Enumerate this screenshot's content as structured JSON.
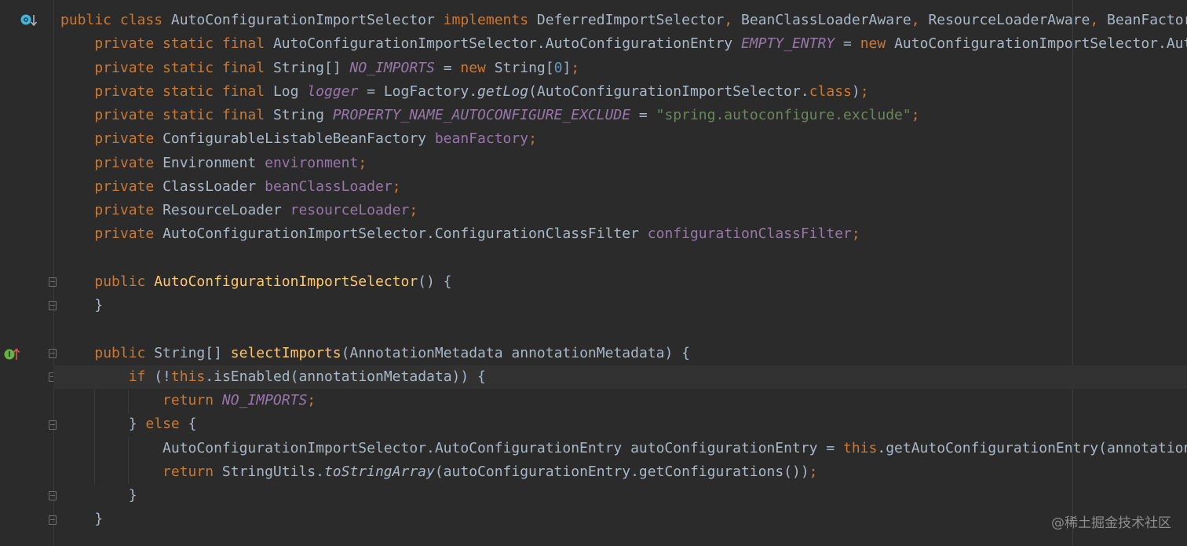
{
  "editor": {
    "lines": [
      {
        "indent": 0,
        "tokens": [
          [
            "kw",
            "public class "
          ],
          [
            "pl",
            "AutoConfigurationImportSelector "
          ],
          [
            "kw",
            "implements "
          ],
          [
            "pl",
            "DeferredImportSelector"
          ],
          [
            "kw",
            ", "
          ],
          [
            "pl",
            "BeanClassLoaderAware"
          ],
          [
            "kw",
            ", "
          ],
          [
            "pl",
            "ResourceLoaderAware"
          ],
          [
            "kw",
            ", "
          ],
          [
            "pl",
            "BeanFactoryAware"
          ]
        ]
      },
      {
        "indent": 1,
        "tokens": [
          [
            "kw",
            "private static final "
          ],
          [
            "pl",
            "AutoConfigurationImportSelector.AutoConfigurationEntry "
          ],
          [
            "cst",
            "EMPTY_ENTRY"
          ],
          [
            "pl",
            " = "
          ],
          [
            "kw",
            "new "
          ],
          [
            "pl",
            "AutoConfigurationImportSelector.AutoConfigurationEntry();"
          ]
        ]
      },
      {
        "indent": 1,
        "tokens": [
          [
            "kw",
            "private static final "
          ],
          [
            "pl",
            "String[] "
          ],
          [
            "cst",
            "NO_IMPORTS"
          ],
          [
            "pl",
            " = "
          ],
          [
            "kw",
            "new "
          ],
          [
            "pl",
            "String["
          ],
          [
            "num",
            "0"
          ],
          [
            "pl",
            "]"
          ],
          [
            "kw",
            ";"
          ]
        ]
      },
      {
        "indent": 1,
        "tokens": [
          [
            "kw",
            "private static final "
          ],
          [
            "pl",
            "Log "
          ],
          [
            "cst",
            "logger"
          ],
          [
            "pl",
            " = LogFactory."
          ],
          [
            "ital",
            "getLog"
          ],
          [
            "pl",
            "(AutoConfigurationImportSelector."
          ],
          [
            "kw",
            "class"
          ],
          [
            "pl",
            ")"
          ],
          [
            "kw",
            ";"
          ]
        ]
      },
      {
        "indent": 1,
        "tokens": [
          [
            "kw",
            "private static final "
          ],
          [
            "pl",
            "String "
          ],
          [
            "cst",
            "PROPERTY_NAME_AUTOCONFIGURE_EXCLUDE"
          ],
          [
            "pl",
            " = "
          ],
          [
            "str",
            "\"spring.autoconfigure.exclude\""
          ],
          [
            "kw",
            ";"
          ]
        ]
      },
      {
        "indent": 1,
        "tokens": [
          [
            "kw",
            "private "
          ],
          [
            "pl",
            "ConfigurableListableBeanFactory "
          ],
          [
            "fld",
            "beanFactory"
          ],
          [
            "kw",
            ";"
          ]
        ]
      },
      {
        "indent": 1,
        "tokens": [
          [
            "kw",
            "private "
          ],
          [
            "pl",
            "Environment "
          ],
          [
            "fld",
            "environment"
          ],
          [
            "kw",
            ";"
          ]
        ]
      },
      {
        "indent": 1,
        "tokens": [
          [
            "kw",
            "private "
          ],
          [
            "pl",
            "ClassLoader "
          ],
          [
            "fld",
            "beanClassLoader"
          ],
          [
            "kw",
            ";"
          ]
        ]
      },
      {
        "indent": 1,
        "tokens": [
          [
            "kw",
            "private "
          ],
          [
            "pl",
            "ResourceLoader "
          ],
          [
            "fld",
            "resourceLoader"
          ],
          [
            "kw",
            ";"
          ]
        ]
      },
      {
        "indent": 1,
        "tokens": [
          [
            "kw",
            "private "
          ],
          [
            "pl",
            "AutoConfigurationImportSelector.ConfigurationClassFilter "
          ],
          [
            "fld",
            "configurationClassFilter"
          ],
          [
            "kw",
            ";"
          ]
        ]
      },
      {
        "indent": 0,
        "tokens": []
      },
      {
        "indent": 1,
        "tokens": [
          [
            "kw",
            "public "
          ],
          [
            "fn",
            "AutoConfigurationImportSelector"
          ],
          [
            "pl",
            "() {"
          ]
        ]
      },
      {
        "indent": 1,
        "tokens": [
          [
            "pl",
            "}"
          ]
        ]
      },
      {
        "indent": 0,
        "tokens": []
      },
      {
        "indent": 1,
        "tokens": [
          [
            "kw",
            "public "
          ],
          [
            "pl",
            "String[] "
          ],
          [
            "fn",
            "selectImports"
          ],
          [
            "pl",
            "(AnnotationMetadata annotationMetadata) {"
          ]
        ]
      },
      {
        "indent": 2,
        "current": true,
        "tokens": [
          [
            "kw",
            "if "
          ],
          [
            "pl",
            "(!"
          ],
          [
            "kw",
            "this"
          ],
          [
            "pl",
            ".isEnabled(annotationMetadata)) {"
          ]
        ]
      },
      {
        "indent": 3,
        "tokens": [
          [
            "kw",
            "return "
          ],
          [
            "cst",
            "NO_IMPORTS"
          ],
          [
            "kw",
            ";"
          ]
        ]
      },
      {
        "indent": 2,
        "tokens": [
          [
            "pl",
            "} "
          ],
          [
            "kw",
            "else "
          ],
          [
            "pl",
            "{"
          ]
        ]
      },
      {
        "indent": 3,
        "tokens": [
          [
            "pl",
            "AutoConfigurationImportSelector.AutoConfigurationEntry autoConfigurationEntry = "
          ],
          [
            "kw",
            "this"
          ],
          [
            "pl",
            ".getAutoConfigurationEntry(annotationMetadata);"
          ]
        ]
      },
      {
        "indent": 3,
        "tokens": [
          [
            "kw",
            "return "
          ],
          [
            "pl",
            "StringUtils."
          ],
          [
            "ital",
            "toStringArray"
          ],
          [
            "pl",
            "(autoConfigurationEntry.getConfigurations())"
          ],
          [
            "kw",
            ";"
          ]
        ]
      },
      {
        "indent": 2,
        "tokens": [
          [
            "pl",
            "}"
          ]
        ]
      },
      {
        "indent": 1,
        "tokens": [
          [
            "pl",
            "}"
          ]
        ]
      }
    ]
  },
  "gutter": {
    "icons": [
      "implemented-interface-icon",
      "overrides-method-icon",
      "intention-bulb-icon"
    ]
  },
  "colors": {
    "background": "#2b2b2b",
    "keyword": "#cc7832",
    "field": "#9876aa",
    "string": "#6a8759",
    "number": "#6897bb",
    "method_declaration": "#ffc66d",
    "plain": "#a9b7c6"
  },
  "watermark": "@稀土掘金技术社区"
}
